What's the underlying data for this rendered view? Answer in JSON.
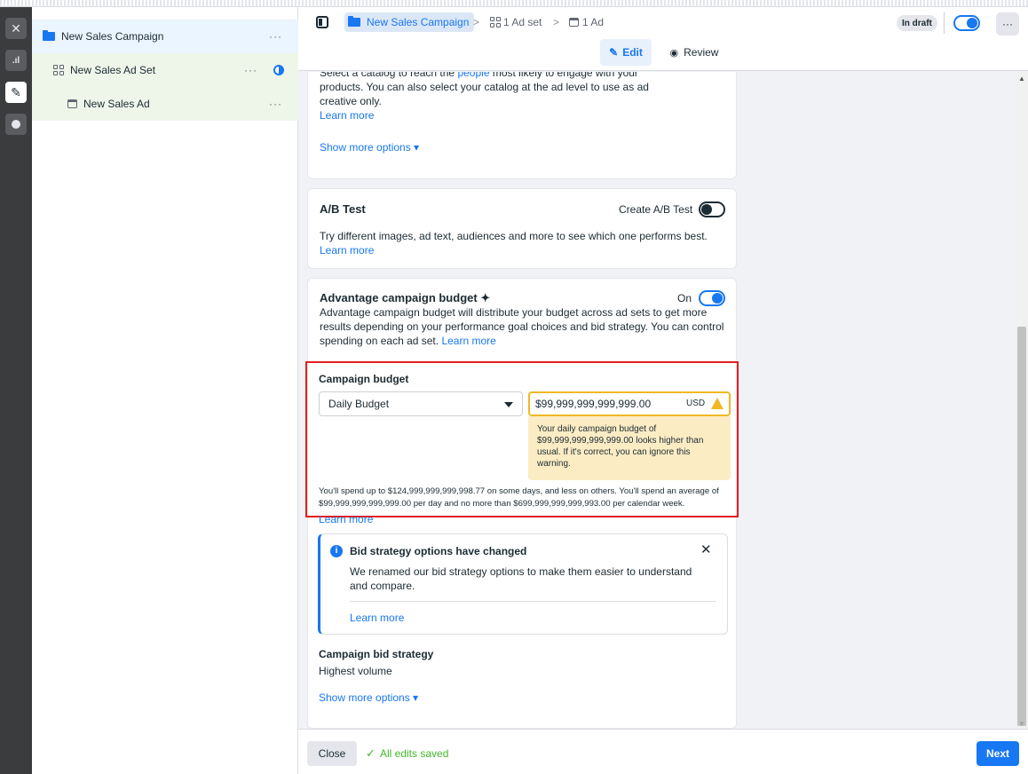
{
  "tree": {
    "campaign": "New Sales Campaign",
    "adset": "New Sales Ad Set",
    "ad": "New Sales Ad",
    "menu": "···"
  },
  "header": {
    "crumb_campaign": "New Sales Campaign",
    "crumb_adset": "1 Ad set",
    "crumb_ad": "1 Ad",
    "sep": ">",
    "status": "In draft",
    "more": "···",
    "tab_edit": "Edit",
    "tab_review": "Review"
  },
  "catalog": {
    "text_partial": "Select a catalog to reach the",
    "text_link": "people",
    "text_rest": "most likely to engage with your products. You can also select your catalog at the ad level to use as ad creative only.",
    "learn_more": "Learn more",
    "show_more": "Show more options ▾"
  },
  "ab_test": {
    "title": "A/B Test",
    "toggle_label": "Create A/B Test",
    "description": "Try different images, ad text, audiences and more to see which one performs best.",
    "learn_more": "Learn more"
  },
  "advantage": {
    "title": "Advantage campaign budget ✦",
    "toggle_label": "On",
    "description": "Advantage campaign budget will distribute your budget across ad sets to get more results depending on your performance goal choices and bid strategy. You can control spending on each ad set.",
    "learn_more": "Learn more"
  },
  "budget": {
    "label": "Campaign budget",
    "type": "Daily Budget",
    "amount": "$99,999,999,999,999.00",
    "currency": "USD",
    "warning": "Your daily campaign budget of $99,999,999,999,999.00 looks higher than usual. If it's correct, you can ignore this warning.",
    "spend_note": "You'll spend up to $124,999,999,999,998.77 on some days, and less on others. You'll spend an average of $99,999,999,999,999.00 per day and no more than $699,999,999,999,993.00 per calendar week.",
    "learn_more": "Learn more"
  },
  "bid_info": {
    "title": "Bid strategy options have changed",
    "body": "We renamed our bid strategy options to make them easier to understand and compare.",
    "learn_more": "Learn more"
  },
  "bid_strategy": {
    "label": "Campaign bid strategy",
    "value": "Highest volume",
    "show_more": "Show more options ▾"
  },
  "footer": {
    "close": "Close",
    "saved": "All edits saved",
    "next": "Next"
  },
  "colors": {
    "accent": "#1877f2",
    "warning": "#f0b823",
    "highlight": "#e41e1e"
  }
}
